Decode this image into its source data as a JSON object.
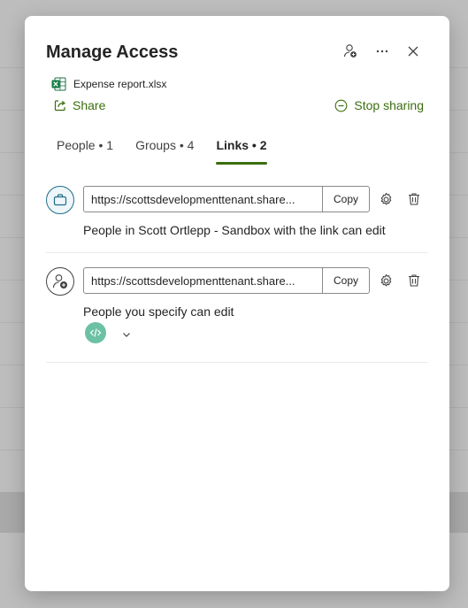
{
  "dialog": {
    "title": "Manage Access",
    "header_icons": [
      "add-person-icon",
      "more-icon",
      "close-icon"
    ]
  },
  "file": {
    "name": "Expense report.xlsx",
    "icon": "excel-icon"
  },
  "actions": {
    "share_label": "Share",
    "stop_sharing_label": "Stop sharing"
  },
  "tabs": [
    {
      "label": "People • 1",
      "active": false
    },
    {
      "label": "Groups • 4",
      "active": false
    },
    {
      "label": "Links • 2",
      "active": true
    }
  ],
  "links": [
    {
      "icon": "briefcase-icon",
      "url": "https://scottsdevelopmenttenant.share...",
      "copy_label": "Copy",
      "description": "People in Scott Ortlepp - Sandbox with the link can edit"
    },
    {
      "icon": "person-add-icon",
      "url": "https://scottsdevelopmenttenant.share...",
      "copy_label": "Copy",
      "description": "People you specify can edit",
      "recipient_icon": "code-icon"
    }
  ],
  "colors": {
    "accent": "#3b6e0e",
    "teal_link_icon": "#1f6e88",
    "recipient_chip": "#6cc1a3"
  }
}
